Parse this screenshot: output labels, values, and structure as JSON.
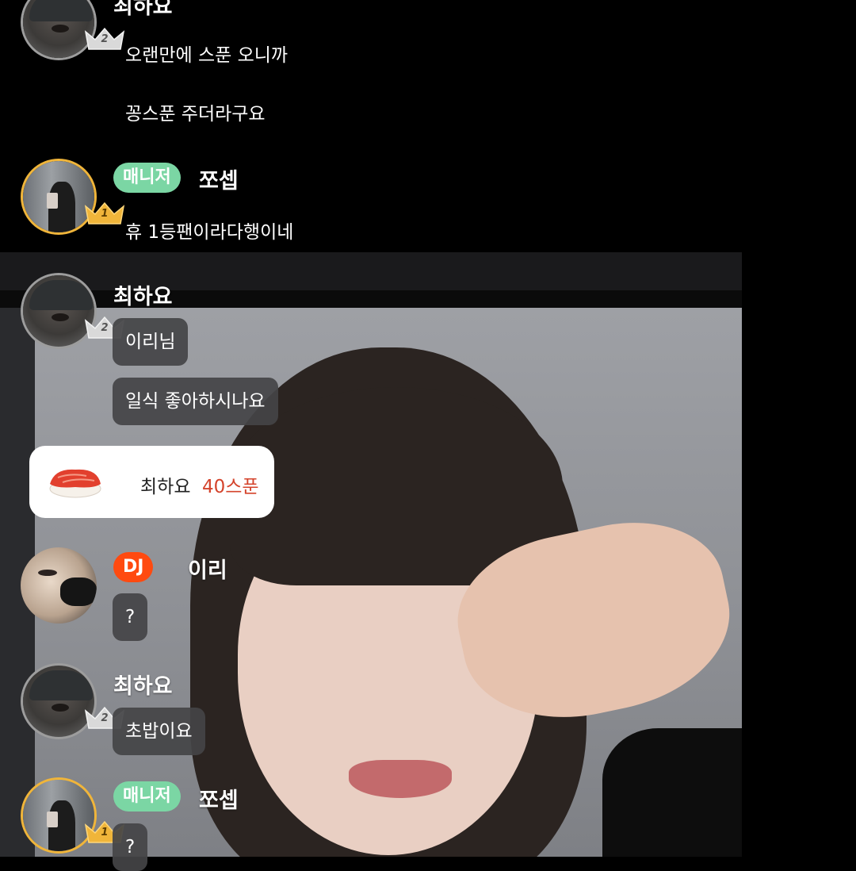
{
  "messages": [
    {
      "user": "최하요",
      "rank": "2",
      "texts": [
        "오랜만에 스푼 오니까",
        "꽁스푼 주더라구요"
      ]
    },
    {
      "user": "쪼셉",
      "role": "매니저",
      "rank": "1",
      "texts": [
        "휴 1등팬이라다행이네"
      ]
    },
    {
      "user": "최하요",
      "rank": "2",
      "texts": [
        "이리님",
        "일식 좋아하시나요"
      ]
    },
    {
      "user": "이리",
      "role": "DJ",
      "texts": [
        "?"
      ]
    },
    {
      "user": "최하요",
      "rank": "2",
      "texts": [
        "초밥이요"
      ]
    },
    {
      "user": "쪼셉",
      "role": "매니저",
      "rank": "1",
      "texts": [
        "?"
      ]
    }
  ],
  "gift": {
    "sender": "최하요",
    "amount": "40스푼",
    "icon": "sushi-icon"
  },
  "colors": {
    "manager_badge": "#7bd6a4",
    "dj_badge": "#ff4a10",
    "gift_amount": "#d4432b",
    "gold_crown": "#f0b53a"
  }
}
